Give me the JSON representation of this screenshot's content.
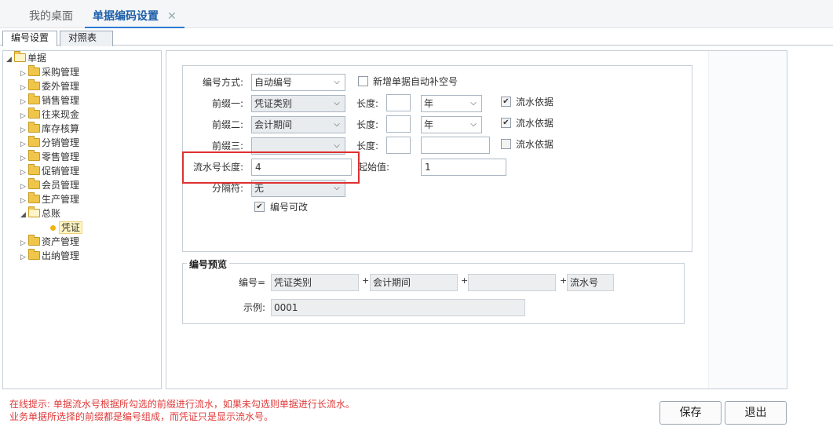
{
  "tabs": {
    "desktop": "我的桌面",
    "active": "单据编码设置",
    "close": "✕"
  },
  "subtabs": {
    "code_settings": "编号设置",
    "mapping": "对照表"
  },
  "tree": {
    "root": "单据",
    "items": [
      "采购管理",
      "委外管理",
      "销售管理",
      "往来现金",
      "库存核算",
      "分销管理",
      "零售管理",
      "促销管理",
      "会员管理",
      "生产管理"
    ],
    "ledger": "总账",
    "voucher": "凭证",
    "items_after": [
      "资产管理",
      "出纳管理"
    ]
  },
  "form": {
    "method_label": "编号方式:",
    "method_value": "自动编号",
    "auto_fill_label": "新增单据自动补空号",
    "prefix1_label": "前缀一:",
    "prefix1_value": "凭证类别",
    "prefix2_label": "前缀二:",
    "prefix2_value": "会计期间",
    "prefix3_label": "前缀三:",
    "prefix3_value": "",
    "length_label": "长度:",
    "year_value": "年",
    "serial_basis_label": "流水依据",
    "serial_length_label": "流水号长度:",
    "serial_length_value": "4",
    "start_label": "起始值:",
    "start_value": "1",
    "separator_label": "分隔符:",
    "separator_value": "无",
    "editable_label": "编号可改"
  },
  "preview": {
    "legend": "编号预览",
    "code_label": "编号=",
    "parts": [
      "凭证类别",
      "会计期间",
      "",
      "流水号"
    ],
    "plus": "+",
    "example_label": "示例:",
    "example_value": "0001"
  },
  "hint": {
    "line1": "在线提示: 单据流水号根据所勾选的前缀进行流水，如果未勾选则单据进行长流水。",
    "line2": "业务单据所选择的前缀都是编号组成，而凭证只是显示流水号。"
  },
  "buttons": {
    "save": "保存",
    "exit": "退出"
  },
  "colors": {
    "accent": "#2e7ad1",
    "highlight": "#e03030",
    "hint": "#e03a3a"
  }
}
